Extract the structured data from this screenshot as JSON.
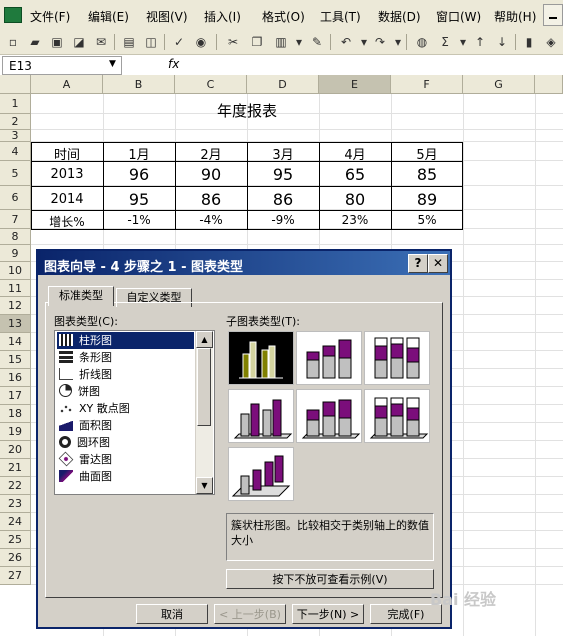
{
  "menubar": {
    "items": [
      "文件(F)",
      "编辑(E)",
      "视图(V)",
      "插入(I)",
      "格式(O)",
      "工具(T)",
      "数据(D)",
      "窗口(W)",
      "帮助(H)"
    ]
  },
  "formula": {
    "cell_ref": "E13",
    "fx": "fx"
  },
  "sheet": {
    "columns": [
      "A",
      "B",
      "C",
      "D",
      "E",
      "F",
      "G"
    ],
    "rows": [
      "1",
      "2",
      "3",
      "4",
      "5",
      "6",
      "7",
      "8",
      "9",
      "10",
      "11",
      "12",
      "13",
      "14",
      "15",
      "16",
      "17",
      "18",
      "19",
      "20",
      "21",
      "22",
      "23",
      "24",
      "25",
      "26",
      "27"
    ],
    "title": "年度报表",
    "header": [
      "时间",
      "1月",
      "2月",
      "3月",
      "4月",
      "5月"
    ],
    "data_rows": [
      [
        "2013",
        "96",
        "90",
        "95",
        "65",
        "85"
      ],
      [
        "2014",
        "95",
        "86",
        "86",
        "80",
        "89"
      ],
      [
        "增长%",
        "-1%",
        "-4%",
        "-9%",
        "23%",
        "5%"
      ]
    ]
  },
  "dialog": {
    "title": "图表向导 - 4 步骤之 1 - 图表类型",
    "help": "?",
    "close": "✕",
    "tabs": [
      "标准类型",
      "自定义类型"
    ],
    "type_label": "图表类型(C):",
    "types": [
      "柱形图",
      "条形图",
      "折线图",
      "饼图",
      "XY 散点图",
      "面积图",
      "圆环图",
      "雷达图",
      "曲面图"
    ],
    "subtype_label": "子图表类型(T):",
    "description": "簇状柱形图。比较相交于类别轴上的数值大小",
    "preview_button": "按下不放可查看示例(V)",
    "buttons": {
      "cancel": "取消",
      "back": "< 上一步(B)",
      "next": "下一步(N) >",
      "finish": "完成(F)"
    }
  },
  "watermark": "Bai 经验",
  "colors": {
    "title_bar": "#0a246a",
    "purple": "#7b0e7b",
    "olive": "#808000"
  }
}
